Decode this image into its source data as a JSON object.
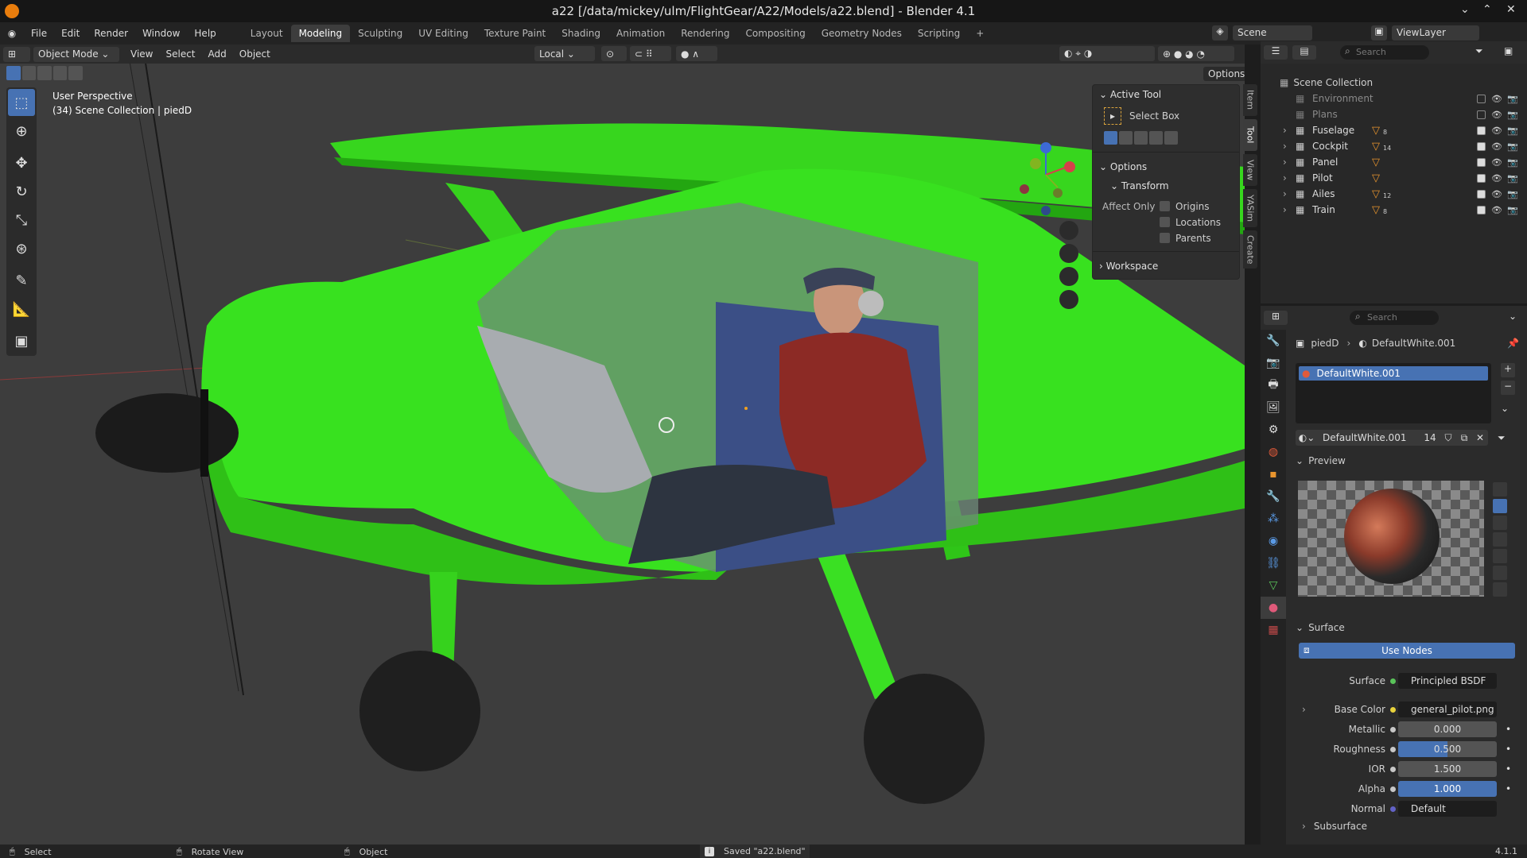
{
  "titlebar": {
    "title": "a22 [/data/mickey/ulm/FlightGear/A22/Models/a22.blend] - Blender 4.1"
  },
  "menu": {
    "items": [
      "File",
      "Edit",
      "Render",
      "Window",
      "Help"
    ]
  },
  "workspaces": {
    "tabs": [
      "Layout",
      "Modeling",
      "Sculpting",
      "UV Editing",
      "Texture Paint",
      "Shading",
      "Animation",
      "Rendering",
      "Compositing",
      "Geometry Nodes",
      "Scripting"
    ],
    "active": "Modeling"
  },
  "topright": {
    "scene": "Scene",
    "viewlayer": "ViewLayer"
  },
  "viewport_header": {
    "mode": "Object Mode",
    "view": "View",
    "select": "Select",
    "add": "Add",
    "object": "Object",
    "orientation": "Local",
    "options": "Options"
  },
  "viewport": {
    "perspective": "User Perspective",
    "collection": "(34) Scene Collection | piedD"
  },
  "npanel": {
    "active_tool_title": "Active Tool",
    "tool_name": "Select Box",
    "options_title": "Options",
    "transform_title": "Transform",
    "affect_only": "Affect Only",
    "origins": "Origins",
    "locations": "Locations",
    "parents": "Parents",
    "workspace_title": "Workspace"
  },
  "sidetabs": [
    "Item",
    "Tool",
    "View",
    "YASim",
    "Create"
  ],
  "outliner": {
    "search_placeholder": "Search",
    "root": "Scene Collection",
    "rows": [
      {
        "name": "Environment",
        "count": "",
        "dim": true
      },
      {
        "name": "Plans",
        "count": "",
        "dim": true
      },
      {
        "name": "Fuselage",
        "count": "8",
        "dim": false
      },
      {
        "name": "Cockpit",
        "count": "14",
        "dim": false
      },
      {
        "name": "Panel",
        "count": "",
        "dim": false
      },
      {
        "name": "Pilot",
        "count": "",
        "dim": false
      },
      {
        "name": "Ailes",
        "count": "12",
        "dim": false
      },
      {
        "name": "Train",
        "count": "8",
        "dim": false
      }
    ]
  },
  "properties": {
    "search_placeholder": "Search",
    "breadcrumb_object": "piedD",
    "breadcrumb_material": "DefaultWhite.001",
    "slot": "DefaultWhite.001",
    "material_name": "DefaultWhite.001",
    "users": "14",
    "preview_title": "Preview",
    "surface_title": "Surface",
    "use_nodes": "Use Nodes",
    "fields": {
      "surface_label": "Surface",
      "surface_value": "Principled BSDF",
      "base_color_label": "Base Color",
      "base_color_value": "general_pilot.png",
      "metallic_label": "Metallic",
      "metallic_value": "0.000",
      "roughness_label": "Roughness",
      "roughness_value": "0.500",
      "ior_label": "IOR",
      "ior_value": "1.500",
      "alpha_label": "Alpha",
      "alpha_value": "1.000",
      "normal_label": "Normal",
      "normal_value": "Default",
      "subsurface_label": "Subsurface"
    }
  },
  "statusbar": {
    "select": "Select",
    "rotate": "Rotate View",
    "object": "Object",
    "message": "Saved \"a22.blend\"",
    "version": "4.1.1"
  },
  "colors": {
    "accent": "#4772b3",
    "plane_green": "#33e01a",
    "grid_bg": "#3d3d3d"
  }
}
